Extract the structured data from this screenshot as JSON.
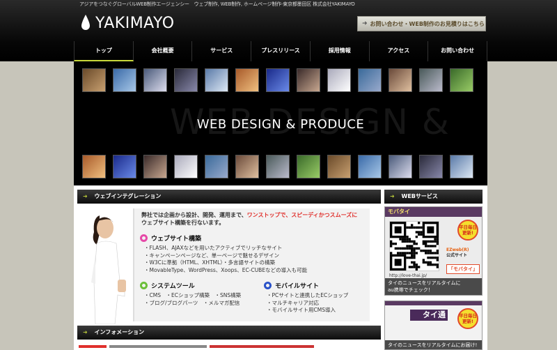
{
  "header": {
    "tagline": "アジアをつなぐグローバルWEB制作エージェンシー　ウェブ制作, WEB制作, ホームページ制作-東京都墨田区 株式会社YAKIMAYO",
    "logo_text": "YAKIMAYO",
    "contact_button": "お問い合わせ・WEB制作のお見積りはこちら"
  },
  "nav": {
    "items": [
      "トップ",
      "会社概要",
      "サービス",
      "プレスリリース",
      "採用情報",
      "アクセス",
      "お問い合わせ"
    ],
    "active": 0
  },
  "banner": {
    "title": "WEB DESIGN & PRODUCE",
    "background_word": "WEB DESIGN &"
  },
  "web_integration": {
    "header": "ウェブインテグレーション",
    "intro_line1_pre": "弊社では企画から設計、開発、運用まで、",
    "intro_line1_red": "ワンストップで、スピーディかつスムーズに",
    "intro_line2": "ウェブサイト構築を行ないます。",
    "website_title": "ウェブサイト構築",
    "website_items": [
      "・FLASH、AJAXなどを用いたアクティブでリッチなサイト",
      "・キャンペーンページなど、単一ページで魅せるデザイン",
      "・W3Cに準拠（HTML、XHTML）・多言語サイトの構築",
      "・MovableType、WordPress、Xoops、EC-CUBEなどの導入も可能"
    ],
    "system_title": "システムツール",
    "system_items": [
      "・CMS　・ECショップ構築　・SNS構築",
      "・ブログ/ブログパーツ　・メルマガ配信"
    ],
    "mobile_title": "モバイルサイト",
    "mobile_items": [
      "・PCサイトと連携したECショップ",
      "・マルチキャリア対応",
      "・モバイルサイト用CMS導入"
    ]
  },
  "information": {
    "header": "インフォメーション"
  },
  "sidebar": {
    "header": "WEBサービス",
    "ad1": {
      "band": "モバタイ",
      "badge": "平日毎日更新!",
      "carrier_line1": "EZweb(R)",
      "carrier_line2": "公式サイト",
      "service_name": "「モバタイ」",
      "url": "http://love-thai.jp/",
      "caption_line1": "タイのニュースをリアルタイムに",
      "caption_line2": "au携帯でチェック！"
    },
    "ad2": {
      "logo": "タイ通",
      "badge": "平日毎日更新!",
      "caption": "タイのニュースをリアルタイムにお届け!"
    }
  },
  "colors": {
    "accent": "#c8d83a",
    "highlight_red": "#e0302c",
    "background": "#c7c5ba",
    "website_ring": "#e64aa8",
    "system_ring": "#6cbf3a",
    "mobile_ring": "#2a52c8"
  }
}
